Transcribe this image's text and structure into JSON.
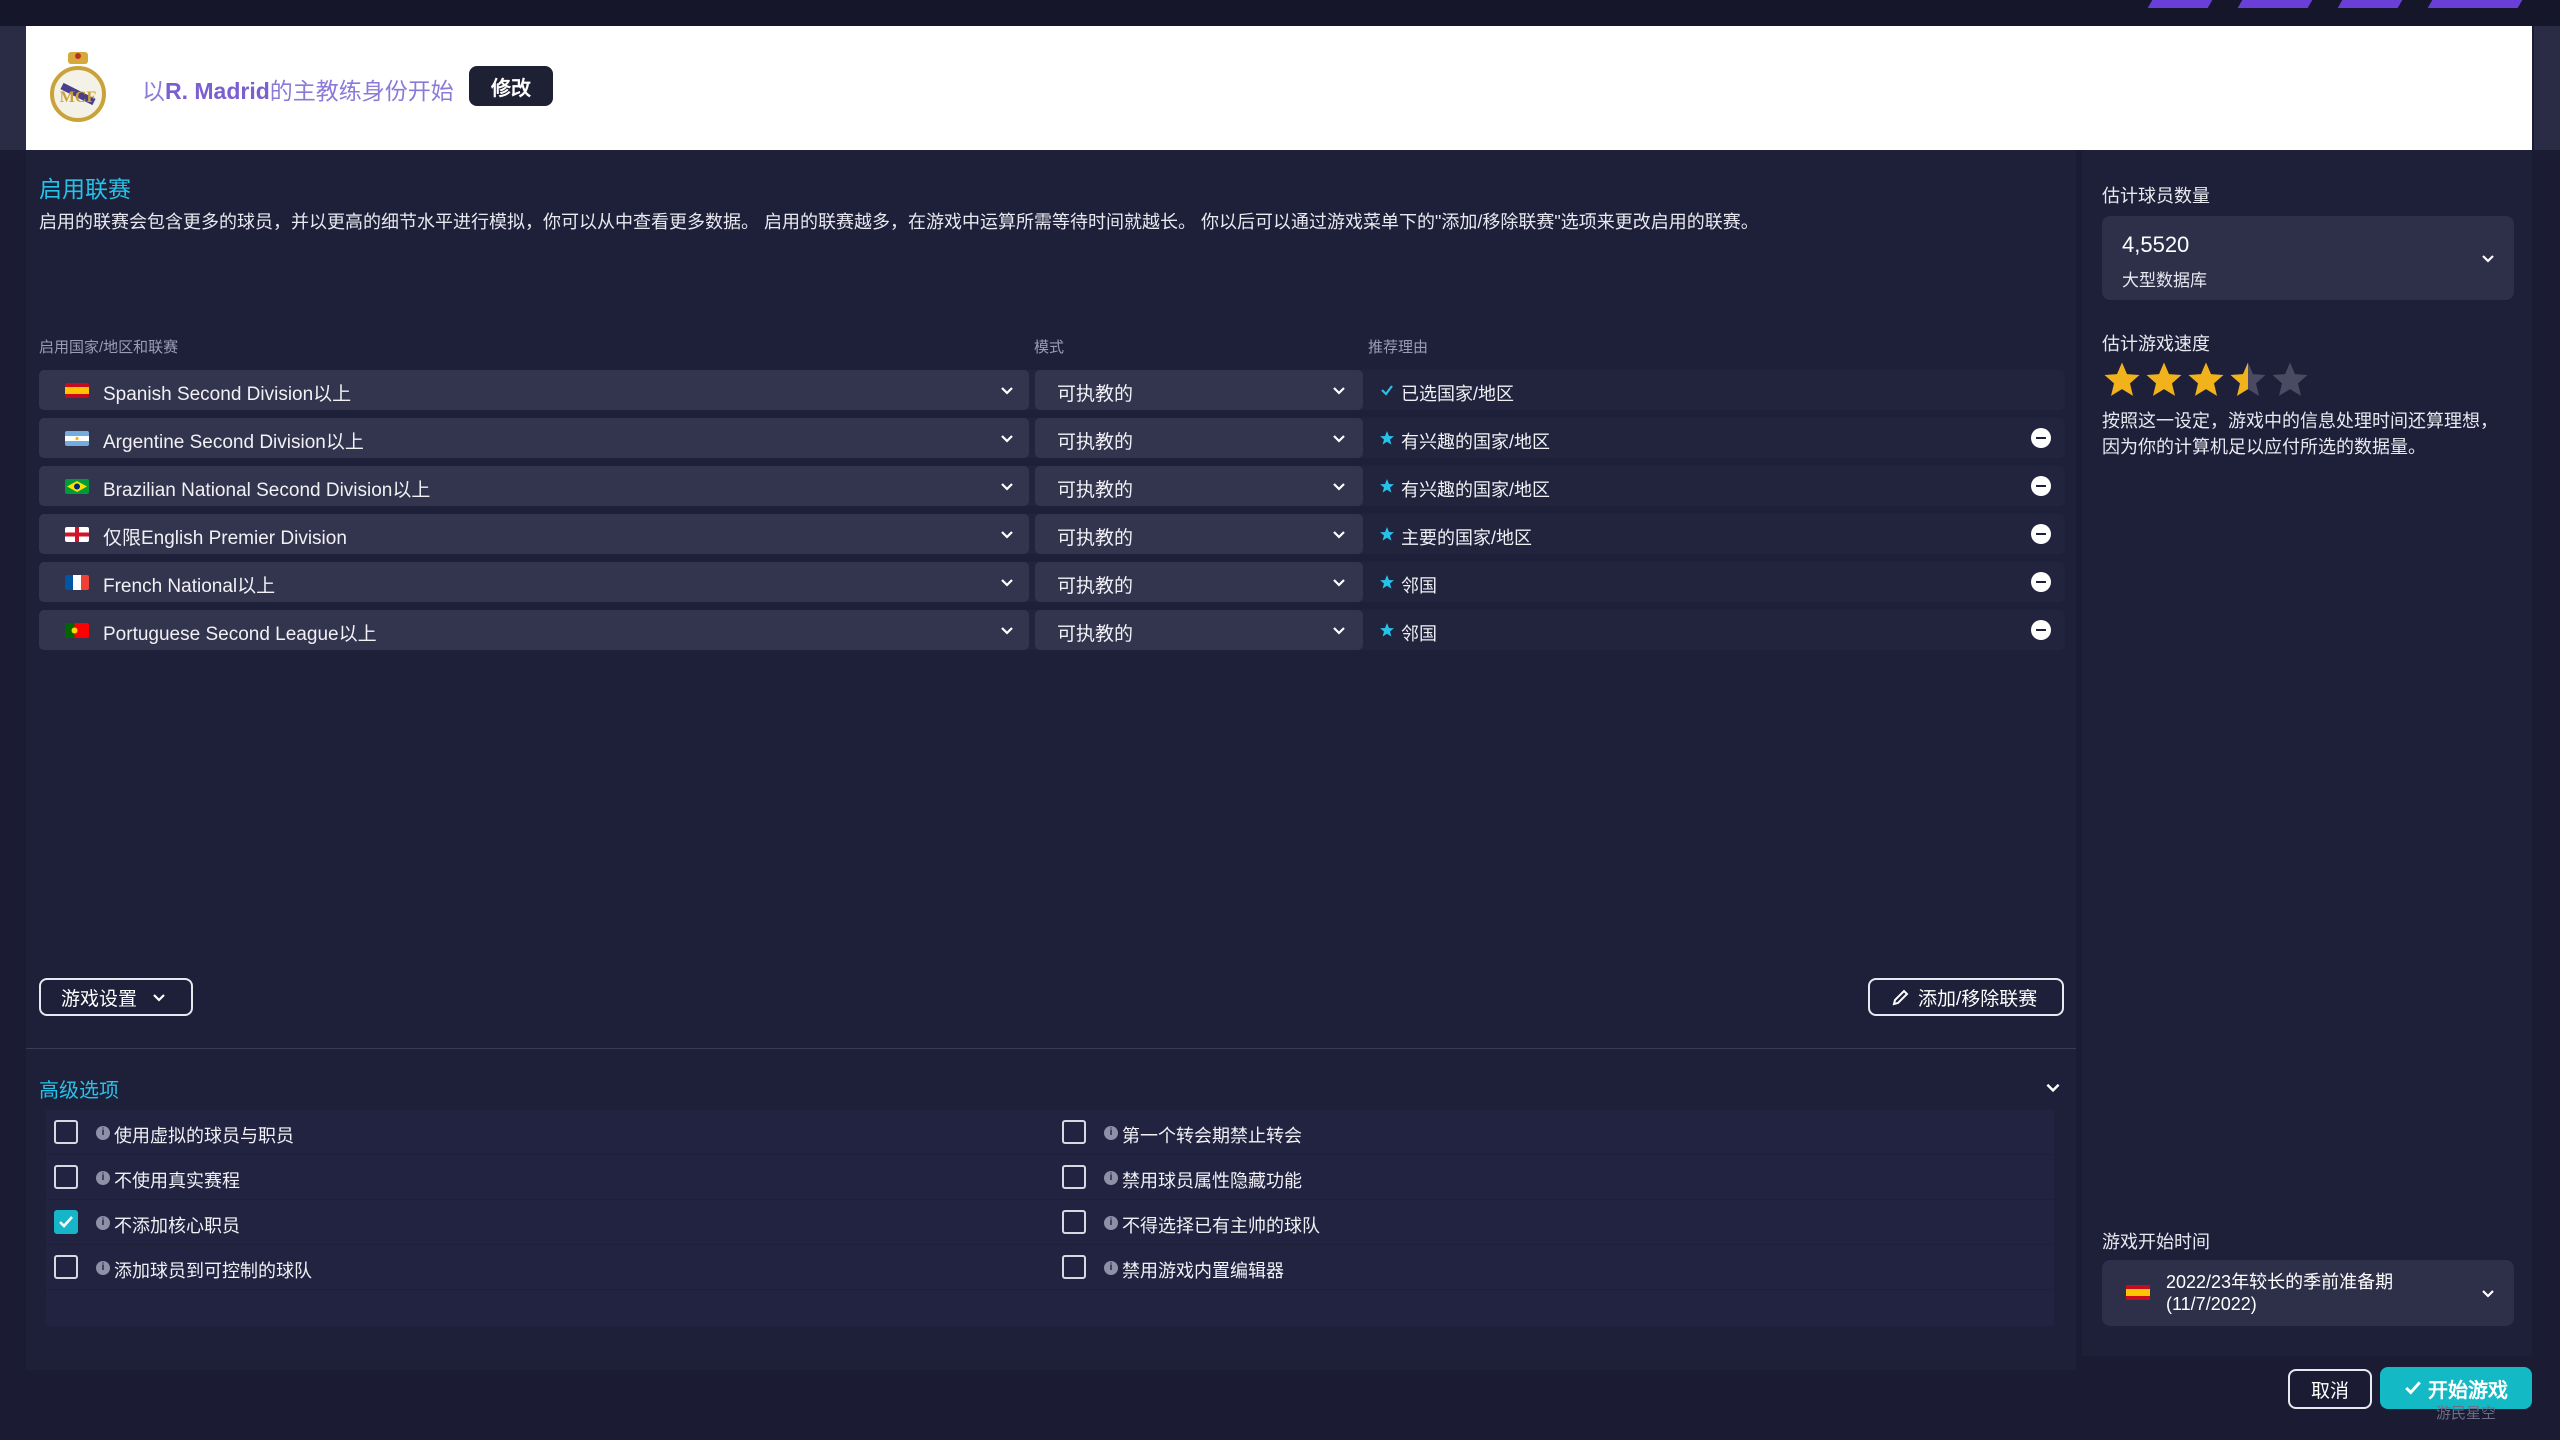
{
  "header": {
    "title_prefix": "以",
    "club": "R. Madrid",
    "title_suffix": "的主教练身份开始",
    "edit_label": "修改"
  },
  "leagues_section": {
    "title": "启用联赛",
    "description": "启用的联赛会包含更多的球员，并以更高的细节水平进行模拟，你可以从中查看更多数据。 启用的联赛越多，在游戏中运算所需等待时间就越长。 你以后可以通过游戏菜单下的\"添加/移除联赛\"选项来更改启用的联赛。",
    "col_league": "启用国家/地区和联赛",
    "col_mode": "模式",
    "col_reason": "推荐理由",
    "rows": [
      {
        "league": "Spanish Second Division以上",
        "mode": "可执教的",
        "reason": "已选国家/地区",
        "reason_icon": "check-icon",
        "removable": false
      },
      {
        "league": "Argentine Second Division以上",
        "mode": "可执教的",
        "reason": "有兴趣的国家/地区",
        "reason_icon": "star-icon",
        "removable": true
      },
      {
        "league": "Brazilian National Second Division以上",
        "mode": "可执教的",
        "reason": "有兴趣的国家/地区",
        "reason_icon": "star-icon",
        "removable": true
      },
      {
        "league": "仅限English Premier Division",
        "mode": "可执教的",
        "reason": "主要的国家/地区",
        "reason_icon": "star-icon",
        "removable": true
      },
      {
        "league": "French National以上",
        "mode": "可执教的",
        "reason": "邻国",
        "reason_icon": "star-icon",
        "removable": true
      },
      {
        "league": "Portuguese Second League以上",
        "mode": "可执教的",
        "reason": "邻国",
        "reason_icon": "star-icon",
        "removable": true
      }
    ],
    "game_settings_label": "游戏设置",
    "add_remove_label": "添加/移除联赛"
  },
  "advanced": {
    "title": "高级选项",
    "options": [
      {
        "label": "使用虚拟的球员与职员",
        "checked": false
      },
      {
        "label": "第一个转会期禁止转会",
        "checked": false
      },
      {
        "label": "不使用真实赛程",
        "checked": false
      },
      {
        "label": "禁用球员属性隐藏功能",
        "checked": false
      },
      {
        "label": "不添加核心职员",
        "checked": true
      },
      {
        "label": "不得选择已有主帅的球队",
        "checked": false
      },
      {
        "label": "添加球员到可控制的球队",
        "checked": false
      },
      {
        "label": "禁用游戏内置编辑器",
        "checked": false
      }
    ]
  },
  "side": {
    "player_count_label": "估计球员数量",
    "player_count_value": "4,5520",
    "player_count_sub": "大型数据库",
    "speed_label": "估计游戏速度",
    "speed_rating": 3.5,
    "speed_max": 5,
    "speed_desc": "按照这一设定，游戏中的信息处理时间还算理想，因为你的计算机足以应付所选的数据量。",
    "start_time_label": "游戏开始时间",
    "start_time_line1": "2022/23年较长的季前准备期",
    "start_time_line2": "(11/7/2022)"
  },
  "footer": {
    "cancel_label": "取消",
    "start_label": "开始游戏",
    "watermark": "游民星空"
  },
  "colors": {
    "accent": "#27c2e8",
    "start_button": "#13b9c4",
    "star": "#f2b21c",
    "header_text": "#8c7ad9"
  }
}
